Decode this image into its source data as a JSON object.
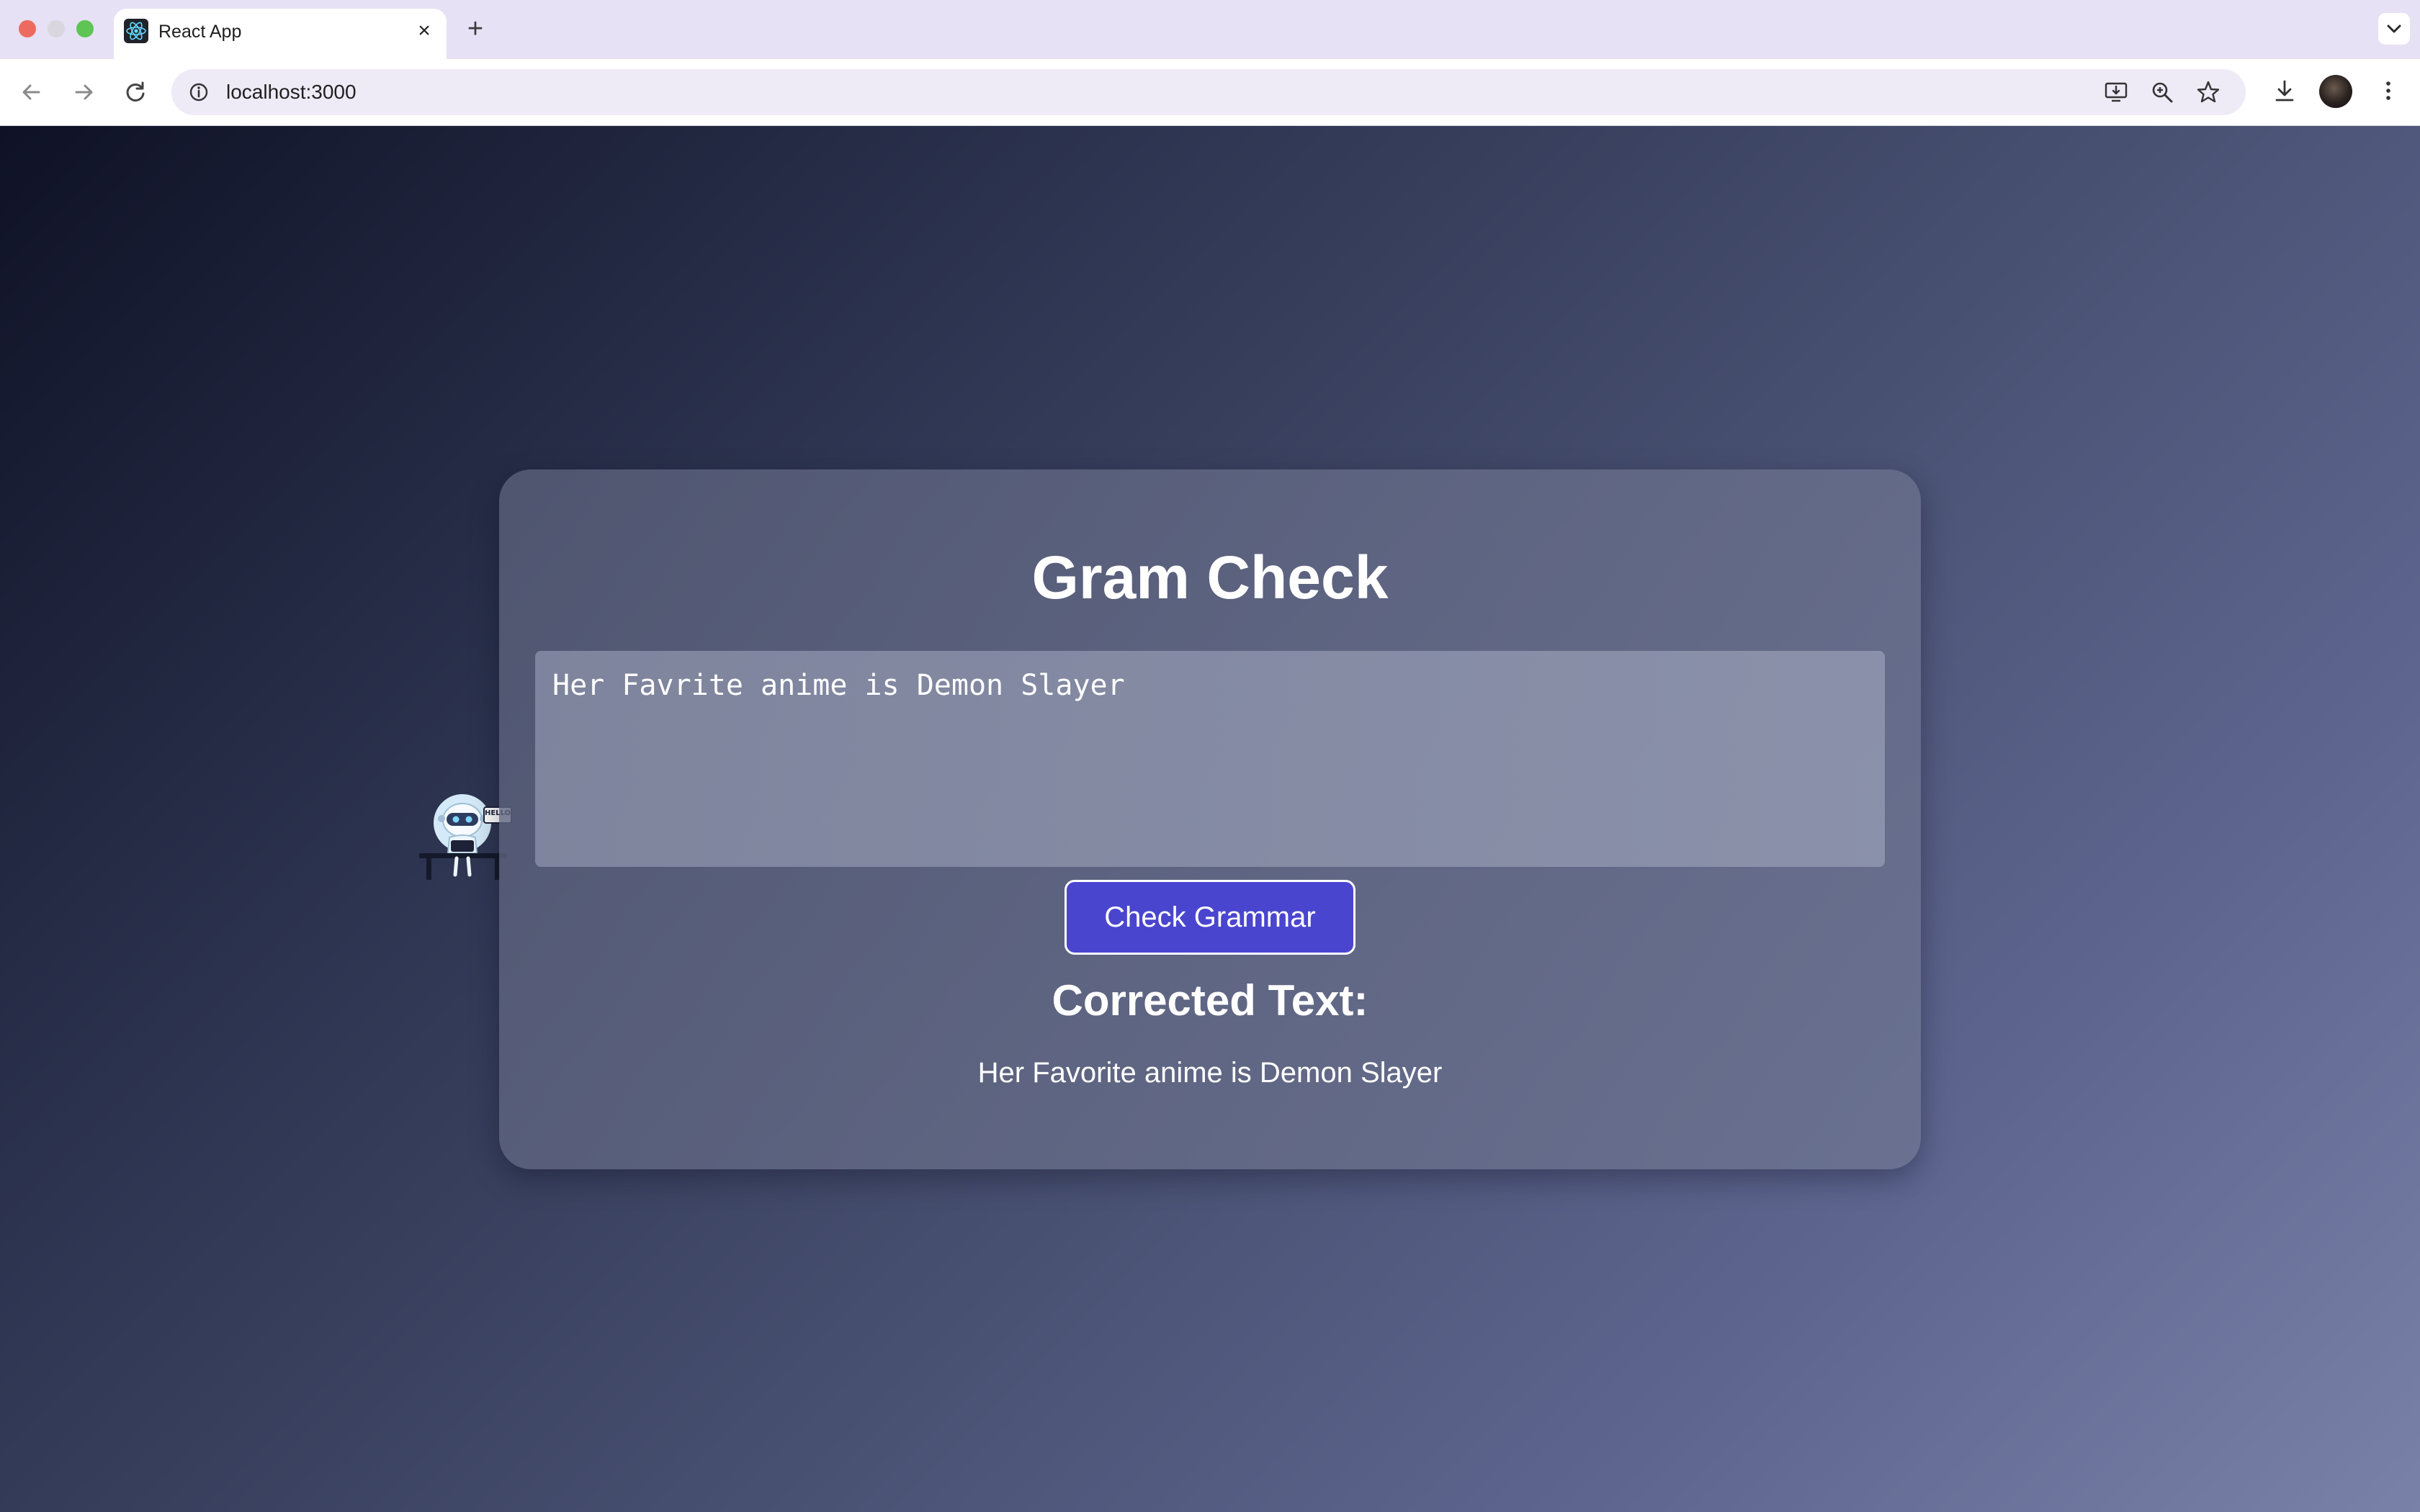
{
  "browser": {
    "tab_title": "React App",
    "tab_close": "×",
    "new_tab": "+",
    "url": "localhost:3000"
  },
  "app": {
    "title": "Gram Check",
    "input_value": "Her Favrite anime is Demon Slayer",
    "check_button_label": "Check Grammar",
    "result_heading": "Corrected Text:",
    "result_text": "Her Favorite anime is Demon Slayer",
    "mascot_sign": "HELLO"
  },
  "colors": {
    "button": "#4a45cf",
    "accent": "#ffffff"
  },
  "icons": [
    "react-icon",
    "back-arrow-icon",
    "forward-arrow-icon",
    "reload-icon",
    "site-info-icon",
    "install-app-icon",
    "zoom-icon",
    "bookmark-star-icon",
    "download-icon",
    "kebab-menu-icon",
    "chevron-down-icon"
  ]
}
